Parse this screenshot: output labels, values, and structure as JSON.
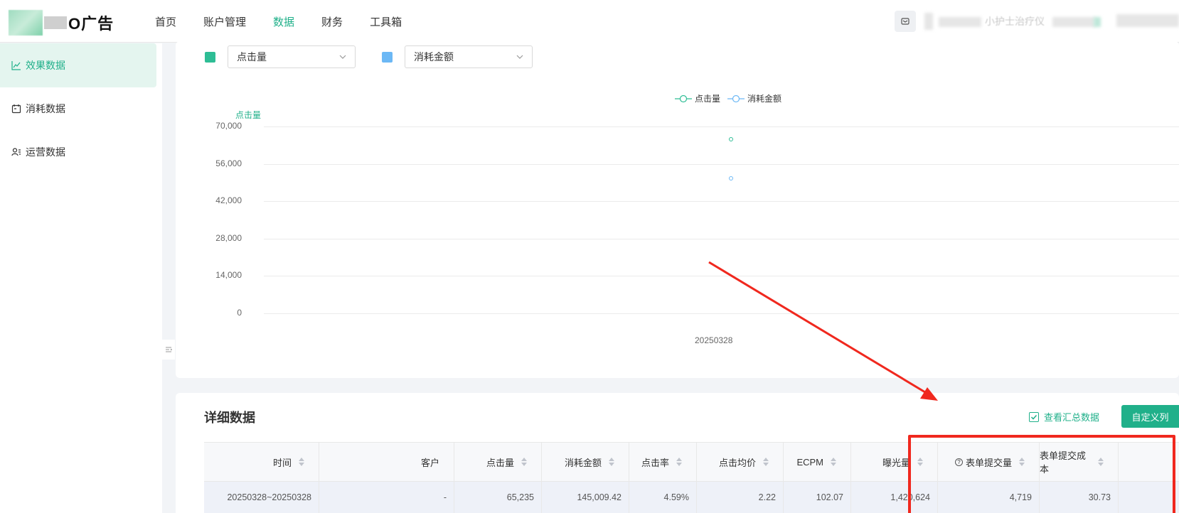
{
  "header": {
    "logo_text": "O广告",
    "nav": [
      {
        "label": "首页",
        "active": false
      },
      {
        "label": "账户管理",
        "active": false
      },
      {
        "label": "数据",
        "active": true
      },
      {
        "label": "财务",
        "active": false
      },
      {
        "label": "工具箱",
        "active": false
      }
    ],
    "user_name_partial": "小护士治疗仪"
  },
  "sidebar": {
    "items": [
      {
        "label": "效果数据",
        "icon": "line-chart-icon",
        "active": true
      },
      {
        "label": "消耗数据",
        "icon": "calendar-icon",
        "active": false
      },
      {
        "label": "运营数据",
        "icon": "user-list-icon",
        "active": false
      }
    ]
  },
  "chart_panel": {
    "metric1": {
      "value": "点击量",
      "color": "#2ebd95"
    },
    "metric2": {
      "value": "消耗金额",
      "color": "#6cb8f5"
    },
    "legend": [
      "点击量",
      "消耗金额"
    ],
    "y_title": "点击量"
  },
  "chart_data": {
    "type": "line",
    "categories": [
      "20250328"
    ],
    "series": [
      {
        "name": "点击量",
        "values": [
          65235
        ],
        "color": "#2ebd95"
      },
      {
        "name": "消耗金额",
        "values": [
          145009.42
        ],
        "color": "#6cb8f5"
      }
    ],
    "ylabel": "点击量",
    "ylim": [
      0,
      70000
    ],
    "yticks": [
      "70,000",
      "56,000",
      "42,000",
      "28,000",
      "14,000",
      "0"
    ],
    "legend_position": "top-center",
    "grid": true
  },
  "detail": {
    "title": "详细数据",
    "summary_checkbox": "查看汇总数据",
    "summary_checked": true,
    "custom_button": "自定义列",
    "columns": [
      "时间",
      "客户",
      "点击量",
      "消耗金额",
      "点击率",
      "点击均价",
      "ECPM",
      "曝光量",
      "表单提交量",
      "表单提交成本"
    ],
    "rows": [
      [
        "20250328~20250328",
        "-",
        "65,235",
        "145,009.42",
        "4.59%",
        "2.22",
        "102.07",
        "1,420,624",
        "4,719",
        "30.73"
      ]
    ]
  },
  "colors": {
    "accent": "#20b08a",
    "annotation": "#f0281e"
  }
}
